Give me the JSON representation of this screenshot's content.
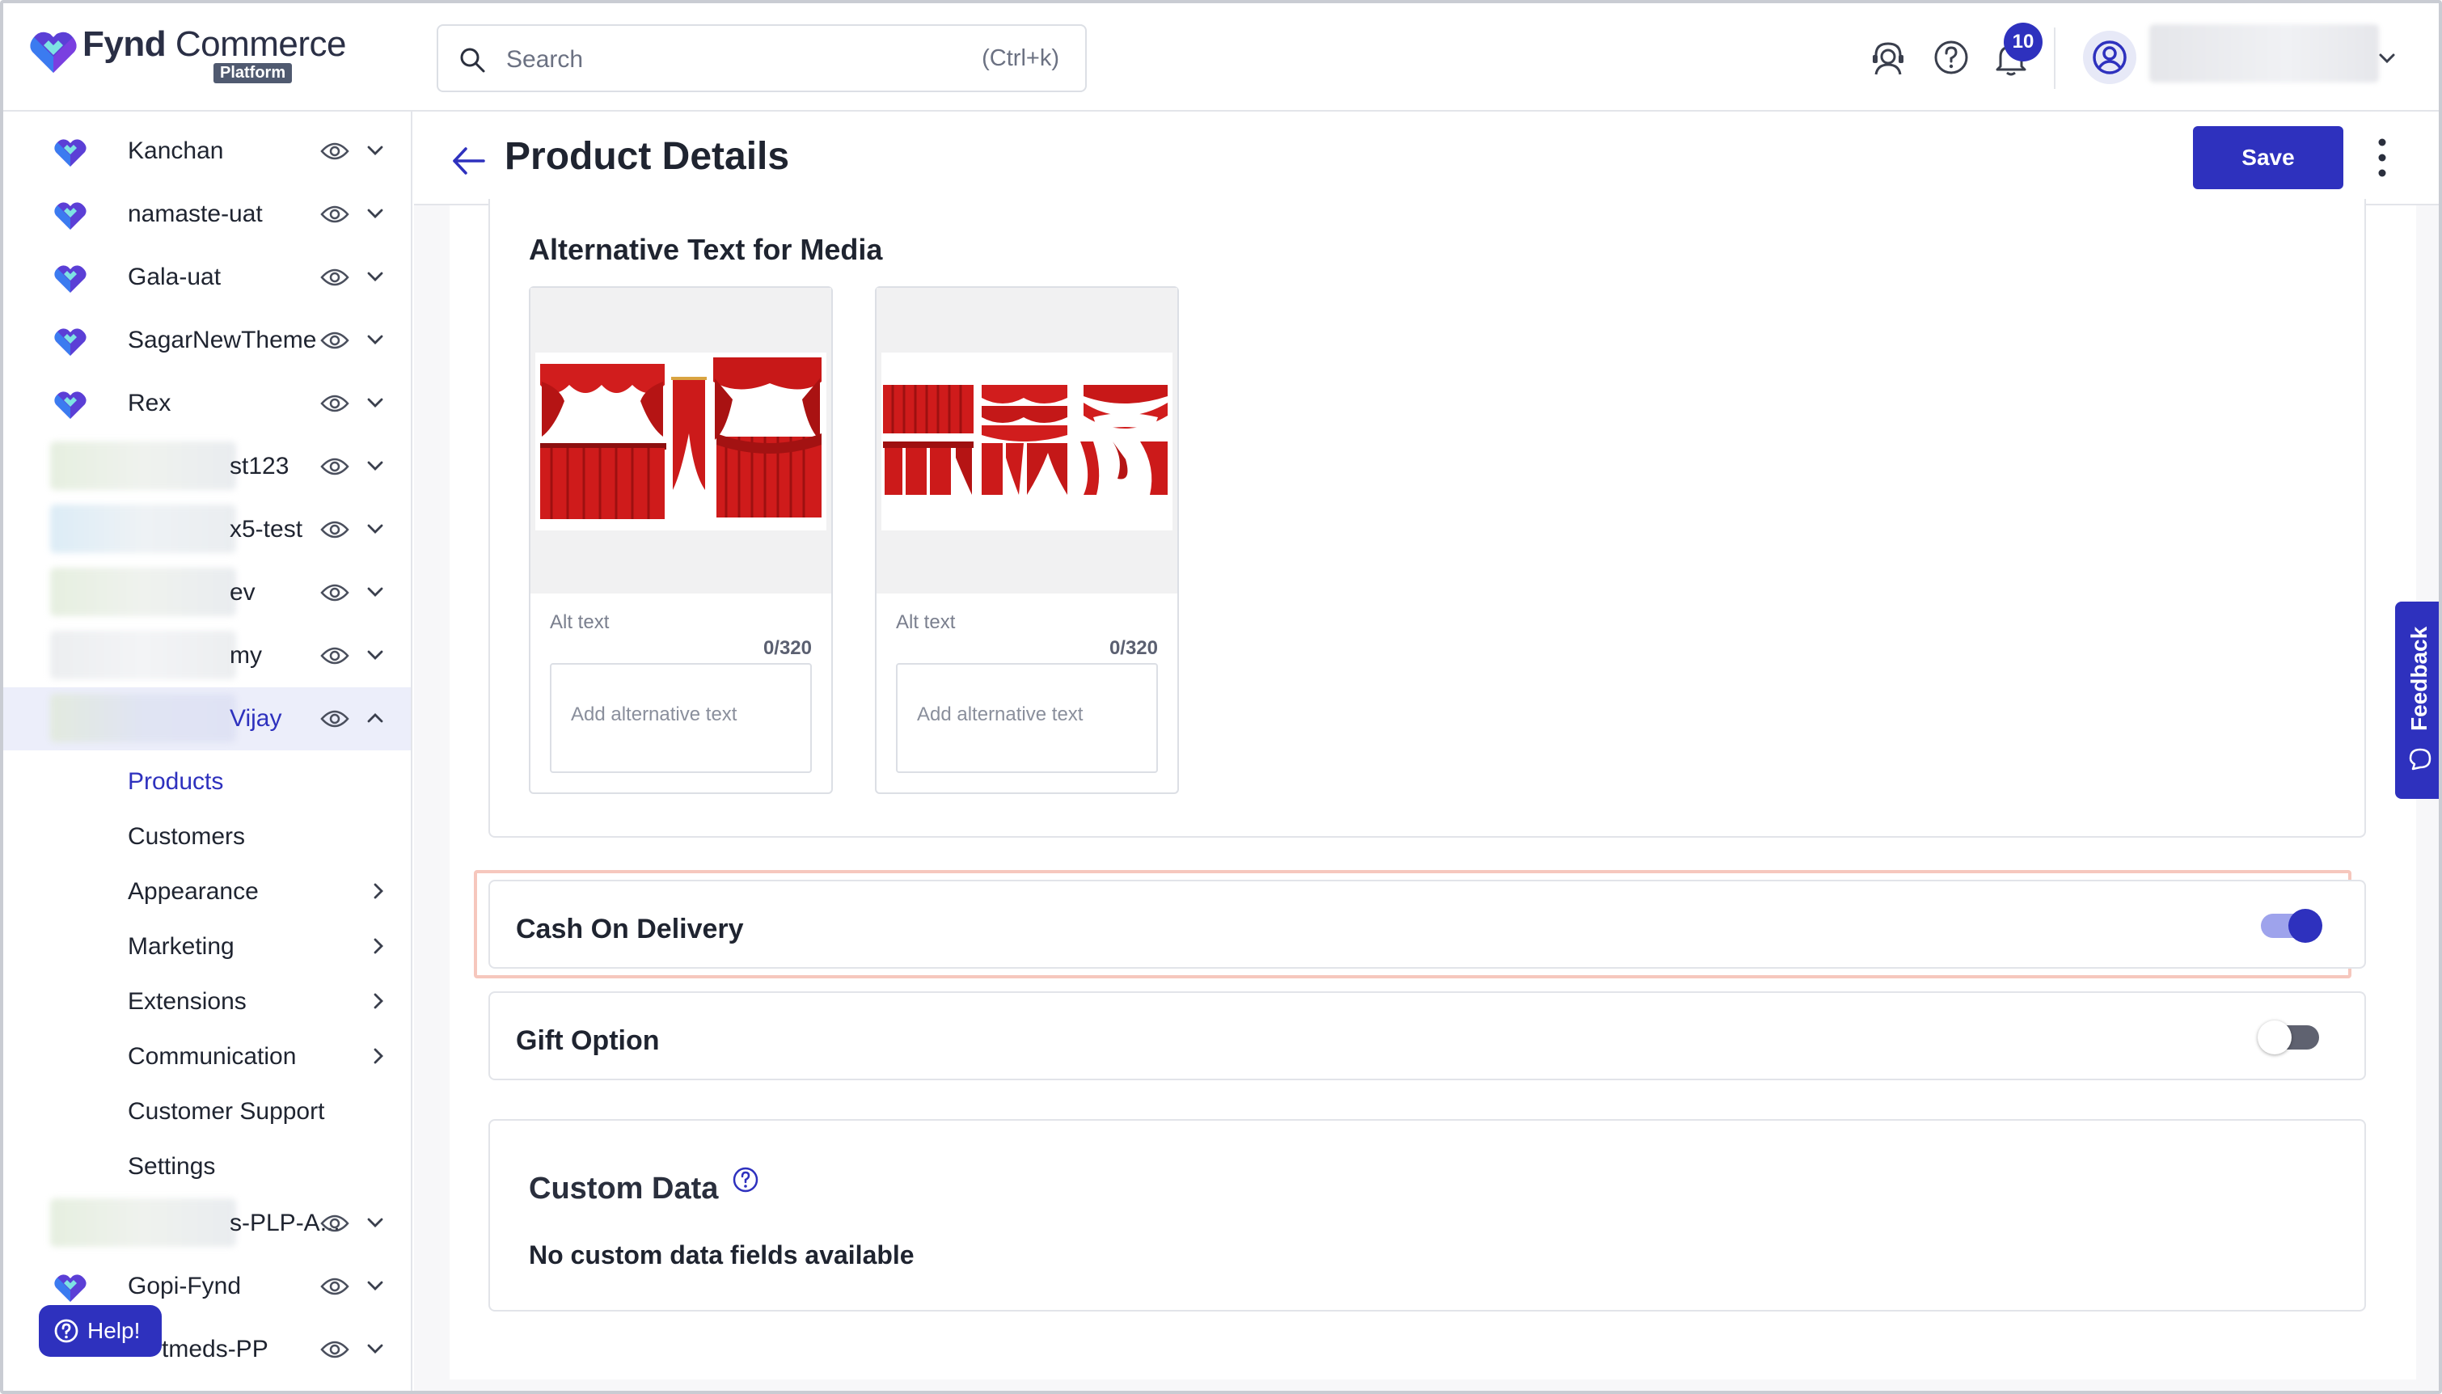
{
  "app": {
    "logo_text": "Fynd Commerce",
    "logo_badge": "Platform"
  },
  "search": {
    "placeholder": "Search",
    "shortcut": "(Ctrl+k)"
  },
  "header_icons": [
    "support-agent-icon",
    "help-circle-icon",
    "bell-icon"
  ],
  "notifications": {
    "count": "10"
  },
  "sidebar": {
    "items": [
      {
        "label": "Kanchan",
        "blurred": false
      },
      {
        "label": "namaste-uat",
        "blurred": false
      },
      {
        "label": "Gala-uat",
        "blurred": false
      },
      {
        "label": "SagarNewTheme",
        "blurred": false
      },
      {
        "label": "Rex",
        "blurred": false
      },
      {
        "label": "st123",
        "blurred": true
      },
      {
        "label": "x5-test",
        "blurred": true
      },
      {
        "label": "ev",
        "blurred": true
      },
      {
        "label": "my",
        "blurred": true
      },
      {
        "label": "Vijay",
        "blurred": true,
        "expanded": true
      },
      {
        "label": "s-PLP-A...",
        "blurred": true
      },
      {
        "label": "Gopi-Fynd",
        "blurred": false
      },
      {
        "label": "tmeds-PP",
        "blurred": true
      }
    ],
    "submenu": [
      {
        "label": "Products",
        "active": true,
        "has_arrow": false
      },
      {
        "label": "Customers",
        "has_arrow": false
      },
      {
        "label": "Appearance",
        "has_arrow": true
      },
      {
        "label": "Marketing",
        "has_arrow": true
      },
      {
        "label": "Extensions",
        "has_arrow": true
      },
      {
        "label": "Communication",
        "has_arrow": true
      },
      {
        "label": "Customer Support",
        "has_arrow": false
      },
      {
        "label": "Settings",
        "has_arrow": false
      }
    ],
    "help_label": "Help!"
  },
  "page": {
    "title": "Product Details",
    "save_label": "Save"
  },
  "media_section": {
    "title": "Alternative Text for Media",
    "tiles": [
      {
        "alt_label": "Alt text",
        "count": "0/320",
        "placeholder": "Add alternative text",
        "value": ""
      },
      {
        "alt_label": "Alt text",
        "count": "0/320",
        "placeholder": "Add alternative text",
        "value": ""
      }
    ]
  },
  "cash_on_delivery": {
    "label": "Cash On Delivery",
    "enabled": true
  },
  "gift_option": {
    "label": "Gift Option",
    "enabled": false
  },
  "custom_data": {
    "title": "Custom Data",
    "empty_message": "No custom data fields available"
  },
  "feedback": {
    "label": "Feedback"
  },
  "colors": {
    "primary": "#2e31be",
    "highlight_border": "#f6c7bd"
  }
}
